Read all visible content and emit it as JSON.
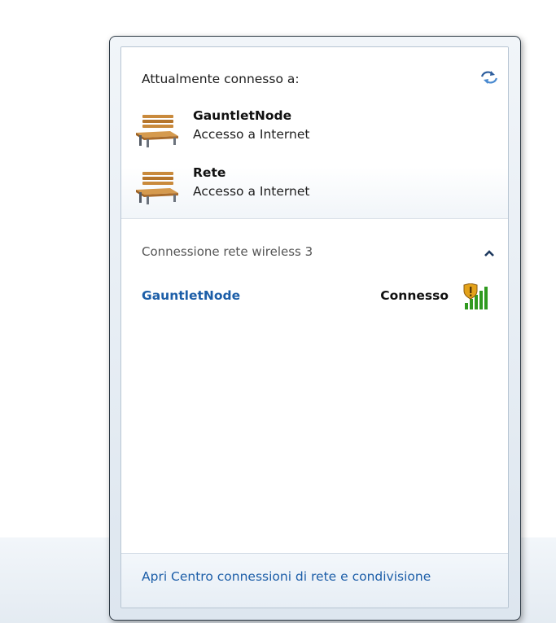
{
  "flyout": {
    "connected_label": "Attualmente connesso a:",
    "refresh_icon": "refresh-arrows-icon",
    "connected_networks": [
      {
        "name": "GauntletNode",
        "status": "Accesso a Internet",
        "icon": "bench-icon"
      },
      {
        "name": "Rete",
        "status": "Accesso a Internet",
        "icon": "bench-icon"
      }
    ],
    "wireless_section": {
      "header": "Connessione rete wireless 3",
      "collapse_icon": "chevron-up-icon",
      "networks": [
        {
          "name": "GauntletNode",
          "status": "Connesso",
          "icon": "wifi-signal-shield-icon"
        }
      ]
    },
    "footer": {
      "link": "Apri Centro connessioni di rete e condivisione"
    }
  },
  "colors": {
    "link": "#1c5ea8",
    "signal": "#2f9a1f",
    "shield": "#e3a21a"
  }
}
